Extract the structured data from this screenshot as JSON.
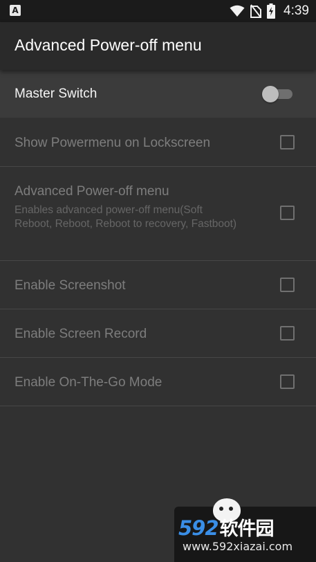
{
  "status_bar": {
    "app_icon_letter": "A",
    "time": "4:39",
    "icons": [
      "wifi-icon",
      "no-sim-icon",
      "battery-charging-icon"
    ]
  },
  "app_bar": {
    "title": "Advanced Power-off menu"
  },
  "master_switch": {
    "label": "Master Switch",
    "checked": false
  },
  "preferences": [
    {
      "title": "Show Powermenu on Lockscreen",
      "summary": "",
      "checked": false
    },
    {
      "title": "Advanced Power-off menu",
      "summary": "Enables advanced power-off menu(Soft Reboot, Reboot, Reboot to recovery, Fastboot)",
      "checked": false
    },
    {
      "title": "Enable Screenshot",
      "summary": "",
      "checked": false
    },
    {
      "title": "Enable Screen Record",
      "summary": "",
      "checked": false
    },
    {
      "title": "Enable On-The-Go Mode",
      "summary": "",
      "checked": false
    }
  ],
  "watermark": {
    "brand": "592",
    "brand_cn": "软件园",
    "url": "www.592xiazai.com"
  },
  "colors": {
    "background": "#313131",
    "app_bar": "#2a2a2a",
    "master_row": "#3b3b3b",
    "disabled_text": "#7d7d7d",
    "divider": "#474747",
    "watermark_blue": "#3a8ee6"
  }
}
